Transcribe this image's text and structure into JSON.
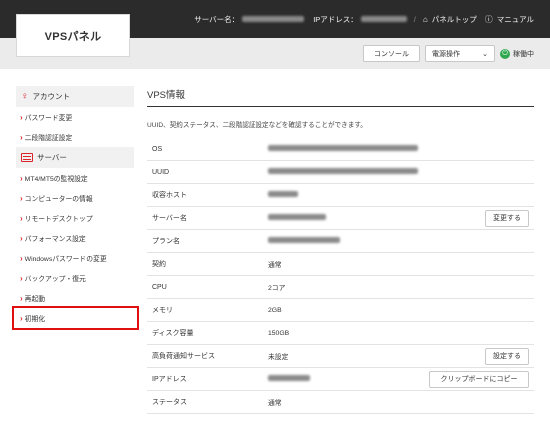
{
  "header": {
    "logo": "VPSパネル",
    "server_name_label": "サーバー名：",
    "ip_label": "IPアドレス：",
    "panel_top": "パネルトップ",
    "manual": "マニュアル",
    "home_icon": "home-icon",
    "help_icon": "help-circle-icon"
  },
  "toolbar": {
    "console": "コンソール",
    "power_select": "電源操作",
    "status": "稼働中",
    "status_color": "#2fa84f"
  },
  "sidebar": {
    "account": {
      "title": "アカウント",
      "icon": "user-icon",
      "items": [
        {
          "label": "パスワード変更"
        },
        {
          "label": "二段階認証設定"
        }
      ]
    },
    "server": {
      "title": "サーバー",
      "icon": "server-icon",
      "items": [
        {
          "label": "MT4/MT5の監視設定"
        },
        {
          "label": "コンピューターの情報"
        },
        {
          "label": "リモートデスクトップ"
        },
        {
          "label": "パフォーマンス設定"
        },
        {
          "label": "Windowsパスワードの変更"
        },
        {
          "label": "バックアップ・復元"
        },
        {
          "label": "再起動"
        },
        {
          "label": "初期化"
        }
      ]
    },
    "accent_color": "#d9252a",
    "highlight_color": "#e01010"
  },
  "main": {
    "title": "VPS情報",
    "description": "UUID、契約ステータス、二段階認証設定などを確認することができます。",
    "rows": [
      {
        "label": "OS"
      },
      {
        "label": "UUID"
      },
      {
        "label": "収容ホスト"
      },
      {
        "label": "サーバー名",
        "action": "変更する"
      },
      {
        "label": "プラン名"
      },
      {
        "label": "契約",
        "value": "通常"
      },
      {
        "label": "CPU",
        "value": "2コア"
      },
      {
        "label": "メモリ",
        "value": "2GB"
      },
      {
        "label": "ディスク容量",
        "value": "150GB"
      },
      {
        "label": "高負荷通知サービス",
        "value": "未設定",
        "action": "設定する"
      },
      {
        "label": "IPアドレス",
        "action": "クリップボードにコピー"
      },
      {
        "label": "ステータス",
        "value": "通常"
      }
    ]
  }
}
